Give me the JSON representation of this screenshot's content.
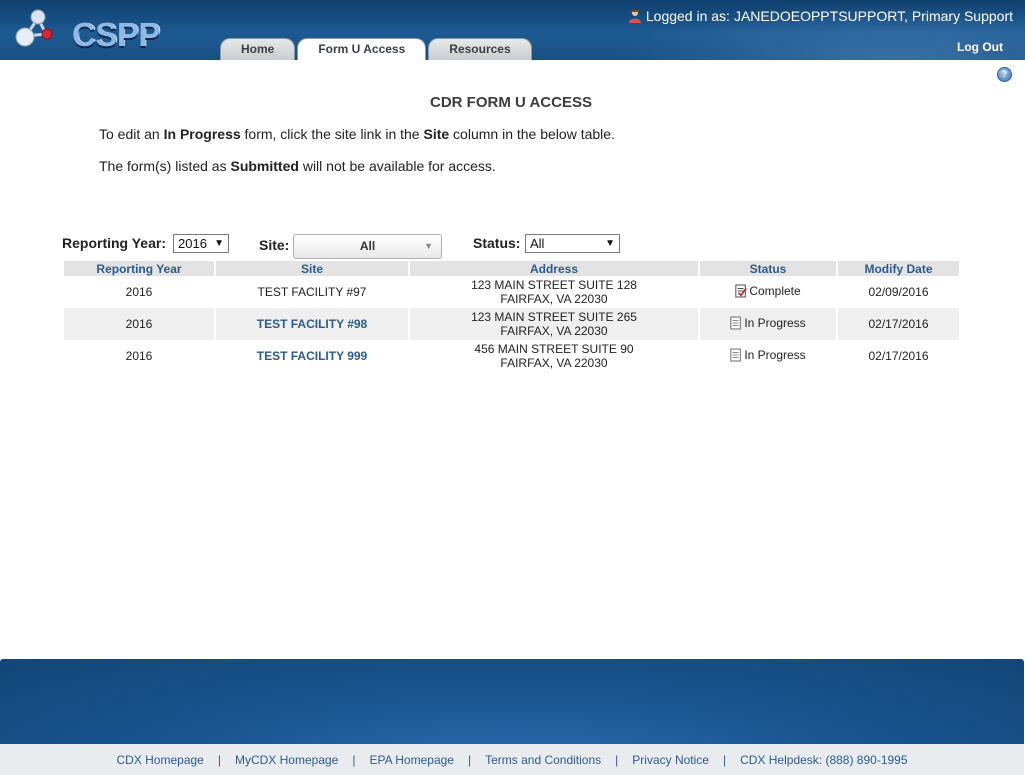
{
  "header": {
    "logo_text": "CSPP",
    "login_prefix": "Logged in as:",
    "login_user": "JANEDOEOPPTSUPPORT, Primary Support",
    "logout": "Log Out"
  },
  "tabs": [
    {
      "label": "Home",
      "active": false
    },
    {
      "label": "Form U Access",
      "active": true
    },
    {
      "label": "Resources",
      "active": false
    }
  ],
  "page": {
    "title": "CDR FORM U ACCESS",
    "instruction1": {
      "a": "To edit an ",
      "b": "In Progress",
      "c": " form, click the site link in the ",
      "d": "Site",
      "e": " column in the below table."
    },
    "instruction2": {
      "a": "The form(s) listed as ",
      "b": "Submitted",
      "c": " will not be available for access."
    }
  },
  "filters": {
    "year_label": "Reporting Year:",
    "year_value": "2016",
    "site_label": "Site:",
    "site_value": "All",
    "status_label": "Status:",
    "status_value": "All"
  },
  "table": {
    "headers": [
      "Reporting Year",
      "Site",
      "Address",
      "Status",
      "Modify Date"
    ],
    "rows": [
      {
        "year": "2016",
        "site": "TEST FACILITY #97",
        "site_link": false,
        "addr1": "123 MAIN STREET SUITE 128",
        "addr2": "FAIRFAX, VA 22030",
        "status": "Complete",
        "date": "02/09/2016"
      },
      {
        "year": "2016",
        "site": "TEST FACILITY #98",
        "site_link": true,
        "addr1": "123 MAIN STREET SUITE 265",
        "addr2": "FAIRFAX, VA 22030",
        "status": "In Progress",
        "date": "02/17/2016"
      },
      {
        "year": "2016",
        "site": "TEST FACILITY 999",
        "site_link": true,
        "addr1": "456 MAIN STREET SUITE 90",
        "addr2": "FAIRFAX, VA 22030",
        "status": "In Progress",
        "date": "02/17/2016"
      }
    ]
  },
  "footer": {
    "links": [
      "CDX Homepage",
      "MyCDX Homepage",
      "EPA Homepage",
      "Terms and Conditions",
      "Privacy Notice",
      "CDX Helpdesk: (888) 890-1995"
    ],
    "separator": "|"
  },
  "icons": {
    "user": "user-icon",
    "help": "help-icon",
    "complete": "document-check-icon",
    "in_progress": "document-icon"
  },
  "colors": {
    "header": "#1d5a92",
    "link": "#2d5b8c",
    "table_header_bg": "#e3e3e3"
  }
}
